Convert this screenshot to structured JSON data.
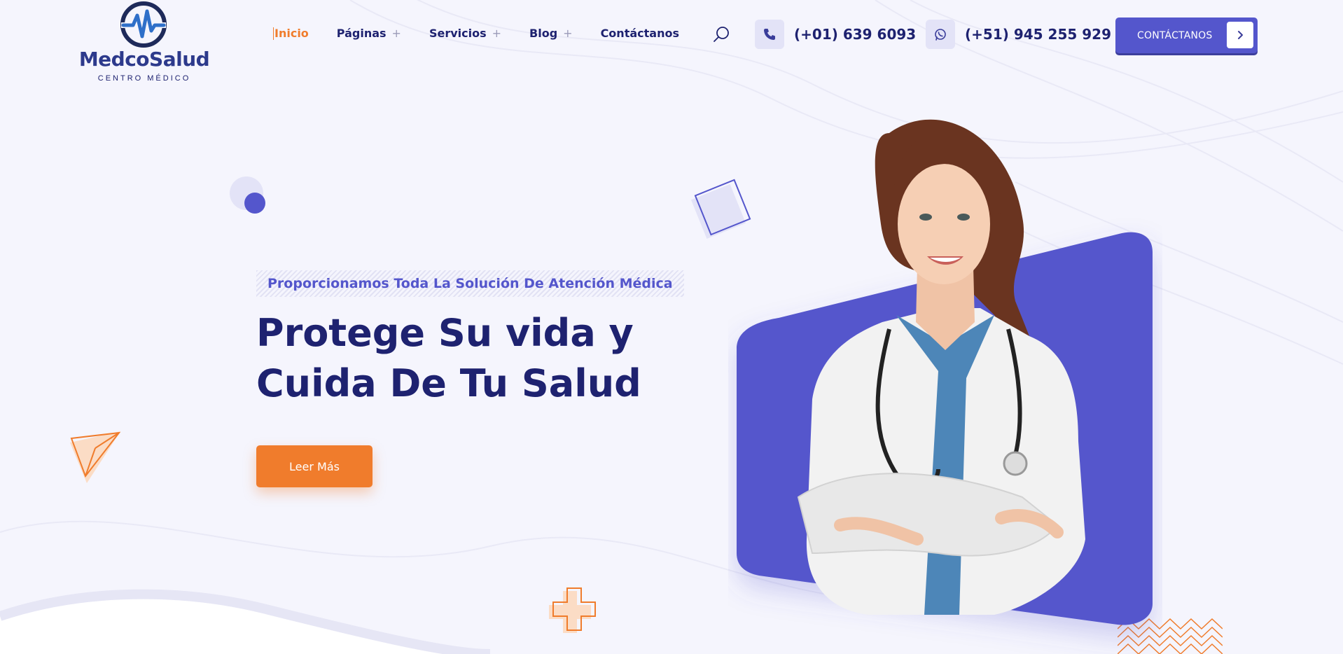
{
  "header": {
    "logo": {
      "brand_part1": "Medco",
      "brand_part2": "Salud",
      "subtitle": "CENTRO MÉDICO"
    },
    "nav": [
      {
        "label": "Inicio",
        "active": true,
        "has_submenu": false
      },
      {
        "label": "Páginas",
        "active": false,
        "has_submenu": true
      },
      {
        "label": "Servicios",
        "active": false,
        "has_submenu": true
      },
      {
        "label": "Blog",
        "active": false,
        "has_submenu": true
      },
      {
        "label": "Contáctanos",
        "active": false,
        "has_submenu": false
      }
    ],
    "submenu_symbol": "+",
    "phone": "(+01) 639 6093",
    "whatsapp": "(+51) 945 255 929",
    "cta_label": "CONTÁCTANOS",
    "icons": {
      "search": "search-icon",
      "phone": "phone-icon",
      "whatsapp": "whatsapp-icon",
      "cta_arrow": "chevron-right-icon"
    }
  },
  "hero": {
    "tagline": "Proporcionamos Toda La Solución De Atención Médica",
    "headline_line1": "Protege Su vida y",
    "headline_line2": "Cuida De Tu Salud",
    "button_label": "Leer Más"
  },
  "colors": {
    "primary": "#5456cc",
    "accent": "#f07c2c",
    "heading": "#1e2270",
    "background": "#f5f5fd"
  }
}
